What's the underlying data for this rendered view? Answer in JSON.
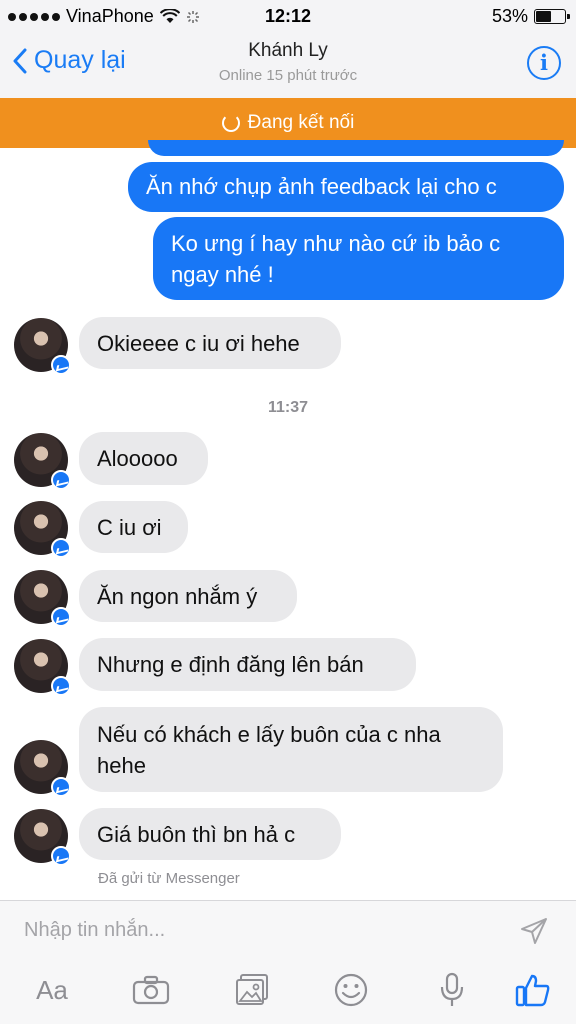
{
  "status": {
    "carrier": "VinaPhone",
    "time": "12:12",
    "battery": "53%"
  },
  "nav": {
    "back_label": "Quay lại",
    "contact_name": "Khánh Ly",
    "presence": "Online 15 phút trước",
    "info_icon": "info-icon"
  },
  "connection": {
    "text": "Đang kết nối"
  },
  "messages": {
    "out1": "Ăn nhớ chụp ảnh feedback lại cho c",
    "out2": "Ko ưng í hay như nào cứ ib bảo c ngay nhé !",
    "in1": "Okieeee c iu ơi hehe",
    "timestamp": "11:37",
    "in2": "Alooooo",
    "in3": "C iu ơi",
    "in4": "Ăn ngon nhắm ý",
    "in5": "Nhưng e định đăng lên bán",
    "in6": "Nếu có khách e lấy buôn của c nha hehe",
    "in7": "Giá buôn thì bn hả c",
    "sent_from": "Đã gửi từ Messenger"
  },
  "composer": {
    "placeholder": "Nhập tin nhắn...",
    "aa_label": "Aa"
  },
  "colors": {
    "accent": "#1877f6",
    "connecting": "#f0901e",
    "incoming_bubble": "#e9e9eb"
  }
}
